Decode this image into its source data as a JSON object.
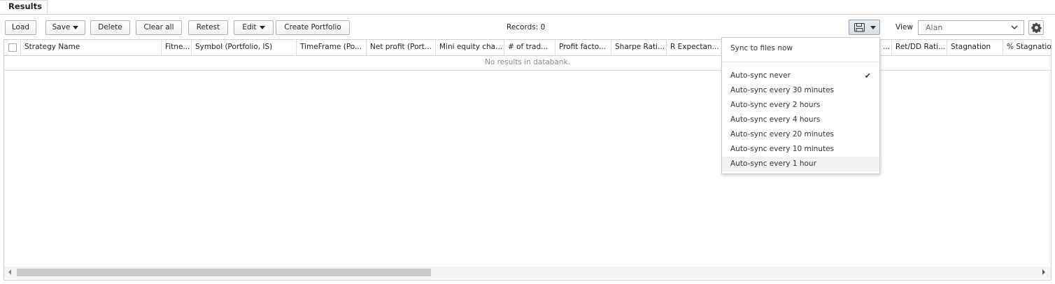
{
  "tabs": [
    {
      "label": "Results",
      "active": true
    }
  ],
  "toolbar": {
    "load": "Load",
    "save": "Save",
    "delete": "Delete",
    "clear_all": "Clear all",
    "retest": "Retest",
    "edit": "Edit",
    "create_portfolio": "Create Portfolio",
    "records": "Records: 0",
    "view_label": "View",
    "view_value": "Alan"
  },
  "grid": {
    "columns": [
      "Strategy Name",
      "Fitne...",
      "Symbol (Portfolio, IS)",
      "TimeFrame (Po...",
      "Net profit (Port...",
      "Mini equity cha...",
      "# of trad...",
      "Profit facto...",
      "Sharpe Rati...",
      "R Expectan...",
      "...",
      "Ret/DD Rati...",
      "Stagnation",
      "% Stagnatio"
    ],
    "empty_message": "No results in databank."
  },
  "sync_menu": {
    "items": [
      {
        "label": "Sync to files now",
        "checked": false
      },
      {
        "label": "Auto-sync never",
        "checked": true
      },
      {
        "label": "Auto-sync every 30 minutes",
        "checked": false
      },
      {
        "label": "Auto-sync every 2 hours",
        "checked": false
      },
      {
        "label": "Auto-sync every 4 hours",
        "checked": false
      },
      {
        "label": "Auto-sync every 20 minutes",
        "checked": false
      },
      {
        "label": "Auto-sync every 10 minutes",
        "checked": false
      },
      {
        "label": "Auto-sync every 1 hour",
        "checked": false,
        "highlighted": true
      }
    ],
    "check_glyph": "✔"
  },
  "colors": {
    "border": "#a9b2bb",
    "menu_highlight": "#f0f1f2"
  },
  "icons": {
    "save": "floppy-disk-icon",
    "settings": "gear-icon",
    "dropdown": "chevron-down-icon"
  }
}
